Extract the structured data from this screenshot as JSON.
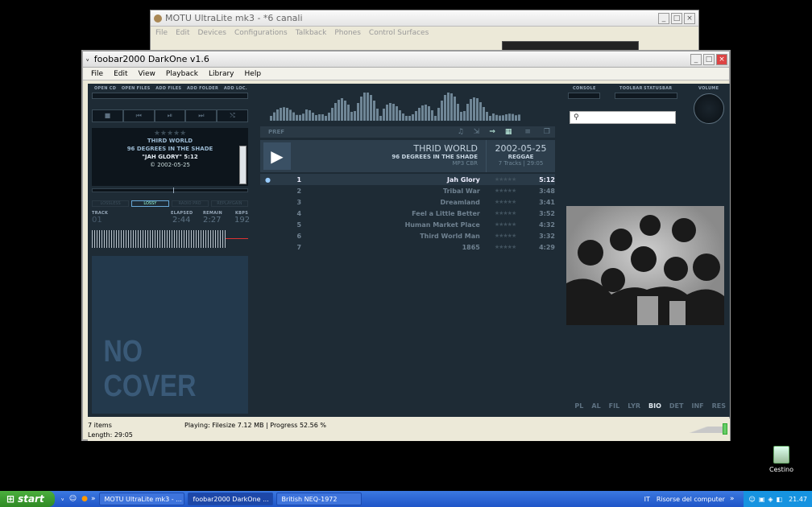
{
  "motu": {
    "title": "MOTU UltraLite mk3 - *6 canali",
    "menu": [
      "File",
      "Edit",
      "Devices",
      "Configurations",
      "Talkback",
      "Phones",
      "Control Surfaces"
    ]
  },
  "window": {
    "title": "foobar2000 DarkOne v1.6",
    "menu": [
      "File",
      "Edit",
      "View",
      "Playback",
      "Library",
      "Help"
    ]
  },
  "toolbar": {
    "buttons": [
      "OPEN CD",
      "OPEN FILES",
      "ADD FILES",
      "ADD FOLDER",
      "ADD LOC."
    ],
    "right_labels": [
      "CONSOLE",
      "TOOLBAR",
      "STATUSBAR",
      "VOLUME"
    ]
  },
  "transport": [
    "■",
    "⏮",
    "⏯",
    "⏭",
    "⤭"
  ],
  "nowplaying": {
    "rating": "★★★★★",
    "artist": "THIRD WORLD",
    "album": "96 DEGREES IN THE SHADE",
    "track": "\"JAH GLORY\" 5:12",
    "date": "© 2002-05-25"
  },
  "modes": [
    "LOSSLESS",
    "LOSSY",
    "RADIO PRO",
    "REPLAYGAIN"
  ],
  "counters": {
    "labels": [
      "TRACK",
      "ELAPSED",
      "REMAIN",
      "KBPS"
    ],
    "track": "01",
    "elapsed": "2:44",
    "remain": "2:27",
    "kbps": "192"
  },
  "cover": {
    "text": "NO COVER"
  },
  "playlist_header": {
    "pref": "PREF"
  },
  "album": {
    "artist": "THRID WORLD",
    "album": "96 DEGREES IN THE SHADE",
    "format": "MP3 CBR",
    "date": "2002-05-25",
    "genre": "REGGAE",
    "tracks_info": "7 Tracks | 29:05"
  },
  "tracks": [
    {
      "num": "1",
      "title": "Jah Glory",
      "len": "5:12",
      "playing": true
    },
    {
      "num": "2",
      "title": "Tribal War",
      "len": "3:48"
    },
    {
      "num": "3",
      "title": "Dreamland",
      "len": "3:41"
    },
    {
      "num": "4",
      "title": "Feel a Little Better",
      "len": "3:52"
    },
    {
      "num": "5",
      "title": "Human Market Place",
      "len": "4:32"
    },
    {
      "num": "6",
      "title": "Third World Man",
      "len": "3:32"
    },
    {
      "num": "7",
      "title": "1865",
      "len": "4:29"
    }
  ],
  "rightnav": [
    "PL",
    "AL",
    "FIL",
    "LYR",
    "BIO",
    "DET",
    "INF",
    "RES"
  ],
  "status": {
    "items": "7 items",
    "length": "Length: 29:05",
    "playing": "Playing:  Filesize 7.12 MB | Progress 52.56 %"
  },
  "desktop": {
    "recycle_label": "Cestino"
  },
  "taskbar": {
    "start": "start",
    "tasks": [
      "MOTU UltraLite mk3 - ...",
      "foobar2000 DarkOne ...",
      "British NEQ-1972"
    ],
    "lang": "IT",
    "computer": "Risorse del computer",
    "clock": "21.47"
  }
}
